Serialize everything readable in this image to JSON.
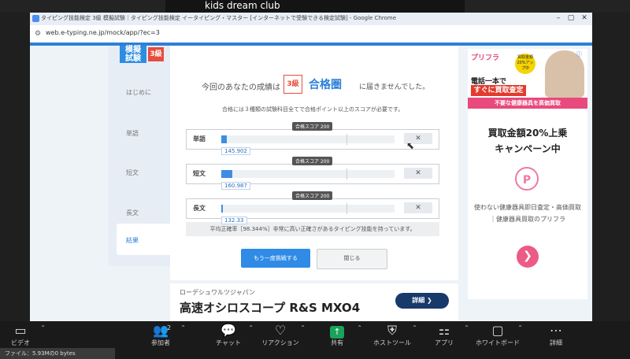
{
  "zoom": {
    "participant_name": "kids dream club",
    "toolbar": [
      {
        "key": "video",
        "label": "ビデオ",
        "icon": "video-camera-icon",
        "glyph": "▭"
      },
      {
        "key": "participants",
        "label": "参加者",
        "icon": "participants-icon",
        "glyph": "👥",
        "count": "2"
      },
      {
        "key": "chat",
        "label": "チャット",
        "icon": "chat-icon",
        "glyph": "💬"
      },
      {
        "key": "reactions",
        "label": "リアクション",
        "icon": "heart-icon",
        "glyph": "♡"
      },
      {
        "key": "share",
        "label": "共有",
        "icon": "share-screen-icon",
        "glyph": "↑"
      },
      {
        "key": "host_tools",
        "label": "ホストツール",
        "icon": "shield-icon",
        "glyph": "⛨"
      },
      {
        "key": "apps",
        "label": "アプリ",
        "icon": "apps-icon",
        "glyph": "⚏"
      },
      {
        "key": "whiteboard",
        "label": "ホワイトボード",
        "icon": "whiteboard-icon",
        "glyph": "▢"
      },
      {
        "key": "details",
        "label": "詳細",
        "icon": "more-icon",
        "glyph": "⋯"
      }
    ],
    "file_status": "ファイル：5.93Mの0 bytes"
  },
  "browser": {
    "title": "タイピング技能検定 3級 模擬試験｜タイピング技能検定 イータイピング・マスター [インターネットで受験できる検定試験] - Google Chrome",
    "url": "web.e-typing.ne.jp/mock/app/?ec=3"
  },
  "exam": {
    "badge_text": "模擬\n試験",
    "badge_grade": "3級",
    "sidebar": [
      "はじめに",
      "単語",
      "短文",
      "長文",
      "結果"
    ],
    "result_prefix": "今回のあなたの成績は",
    "grade": "3級",
    "goukaku": "合格圏",
    "not_reach": "に届きませんでした。",
    "note": "合格には３種類の試験科目全てで合格ポイント以上のスコアが必要です。",
    "pass_tag": "合格スコア 200",
    "rows": [
      {
        "label": "単語",
        "score": "145.902"
      },
      {
        "label": "短文",
        "score": "160.987"
      },
      {
        "label": "長文",
        "score": "132.33"
      }
    ],
    "summary": "平均正確率［98.344%］非常に高い正確さがあるタイピング技能を持っています。",
    "retry_label": "もう一度挑戦する",
    "close_label": "閉じる"
  },
  "bottom_ad": {
    "company": "ローデシュワルツジャパン",
    "product": "高速オシロスコープ R&S MXO4",
    "detail_label": "詳細 ❯"
  },
  "right_ad": {
    "logo": "プリフラ",
    "badge": "買取金額20%アップ中",
    "phone": "電話一本で",
    "sugu": "すぐに買取査定",
    "banner": "不要な健康器具を高価買取",
    "headline1": "買取金額20%上乗",
    "headline2": "キャンペーン中",
    "logo_glyph": "P",
    "body": "使わない健康器具即日査定・高価買取｜健康器具買取のプリフラ",
    "arrow": "❯"
  },
  "chart_data": {
    "type": "bar",
    "categories": [
      "単語",
      "短文",
      "長文"
    ],
    "values": [
      145.902,
      160.987,
      132.33
    ],
    "ylim": [
      0,
      400
    ],
    "pass_line": 200
  }
}
